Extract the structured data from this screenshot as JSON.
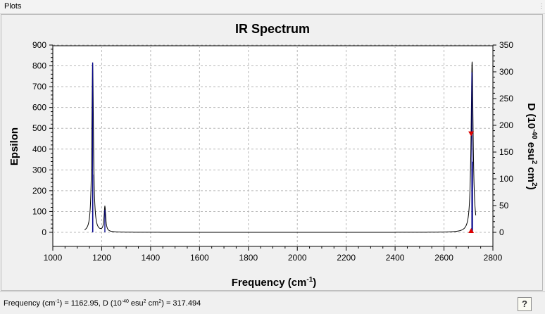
{
  "window": {
    "title": "Plots"
  },
  "chart_data": {
    "type": "line",
    "title": "IR Spectrum",
    "xlabel": "Frequency (cm",
    "xlabel_sup": "-1",
    "xlabel_close": ")",
    "ylabel_left": "Epsilon",
    "ylabel_right": "D (10",
    "ylabel_right_sup1": "-40",
    "ylabel_right_mid": " esu",
    "ylabel_right_sup2": "2",
    "ylabel_right_mid2": " cm",
    "ylabel_right_sup3": "2",
    "ylabel_right_close": ")",
    "xlim": [
      1000,
      2800
    ],
    "ylim_left": [
      0,
      900
    ],
    "ylim_right": [
      0,
      350
    ],
    "x_ticks": [
      1000,
      1200,
      1400,
      1600,
      1800,
      2000,
      2200,
      2400,
      2600,
      2800
    ],
    "y_left_ticks": [
      0,
      100,
      200,
      300,
      400,
      500,
      600,
      700,
      800,
      900
    ],
    "y_right_ticks": [
      0,
      50,
      100,
      150,
      200,
      250,
      300,
      350
    ],
    "grid": true,
    "spectrum_peaks": [
      {
        "x": 1162.95,
        "epsilon": 815,
        "width": 4
      },
      {
        "x": 1213,
        "epsilon": 120,
        "width": 4
      },
      {
        "x": 2715,
        "epsilon": 820,
        "width": 5
      }
    ],
    "stick_series": [
      {
        "x": 1162.95,
        "d": 317.494
      },
      {
        "x": 1163.6,
        "d": 108
      },
      {
        "x": 1213,
        "d": 42
      },
      {
        "x": 2714,
        "d": 299
      },
      {
        "x": 2716.5,
        "d": 132
      }
    ],
    "markers": [
      {
        "x": 2711,
        "epsilon": 475,
        "shape": "triangle-down",
        "color": "#dd0000"
      },
      {
        "x": 2711,
        "epsilon": 0,
        "shape": "triangle-up",
        "color": "#dd0000"
      }
    ],
    "colors": {
      "spectrum": "#000000",
      "sticks": "#00008b",
      "markers": "#dd0000",
      "grid": "#b8b8b8"
    }
  },
  "status": {
    "frequency_label": "Frequency (cm",
    "frequency_sup": "-1",
    "frequency_value": ") = 1162.95, D (10",
    "d_sup1": "-40",
    "d_mid": " esu",
    "d_sup2": "2",
    "d_mid2": " cm",
    "d_sup3": "2",
    "d_value": ") = 317.494",
    "help_label": "?"
  }
}
